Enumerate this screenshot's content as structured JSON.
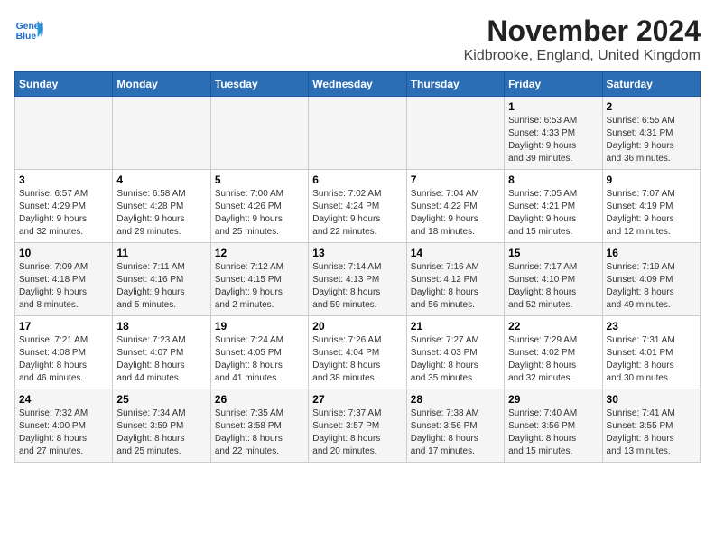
{
  "header": {
    "logo_line1": "General",
    "logo_line2": "Blue",
    "title": "November 2024",
    "subtitle": "Kidbrooke, England, United Kingdom"
  },
  "columns": [
    "Sunday",
    "Monday",
    "Tuesday",
    "Wednesday",
    "Thursday",
    "Friday",
    "Saturday"
  ],
  "weeks": [
    [
      {
        "day": "",
        "info": ""
      },
      {
        "day": "",
        "info": ""
      },
      {
        "day": "",
        "info": ""
      },
      {
        "day": "",
        "info": ""
      },
      {
        "day": "",
        "info": ""
      },
      {
        "day": "1",
        "info": "Sunrise: 6:53 AM\nSunset: 4:33 PM\nDaylight: 9 hours\nand 39 minutes."
      },
      {
        "day": "2",
        "info": "Sunrise: 6:55 AM\nSunset: 4:31 PM\nDaylight: 9 hours\nand 36 minutes."
      }
    ],
    [
      {
        "day": "3",
        "info": "Sunrise: 6:57 AM\nSunset: 4:29 PM\nDaylight: 9 hours\nand 32 minutes."
      },
      {
        "day": "4",
        "info": "Sunrise: 6:58 AM\nSunset: 4:28 PM\nDaylight: 9 hours\nand 29 minutes."
      },
      {
        "day": "5",
        "info": "Sunrise: 7:00 AM\nSunset: 4:26 PM\nDaylight: 9 hours\nand 25 minutes."
      },
      {
        "day": "6",
        "info": "Sunrise: 7:02 AM\nSunset: 4:24 PM\nDaylight: 9 hours\nand 22 minutes."
      },
      {
        "day": "7",
        "info": "Sunrise: 7:04 AM\nSunset: 4:22 PM\nDaylight: 9 hours\nand 18 minutes."
      },
      {
        "day": "8",
        "info": "Sunrise: 7:05 AM\nSunset: 4:21 PM\nDaylight: 9 hours\nand 15 minutes."
      },
      {
        "day": "9",
        "info": "Sunrise: 7:07 AM\nSunset: 4:19 PM\nDaylight: 9 hours\nand 12 minutes."
      }
    ],
    [
      {
        "day": "10",
        "info": "Sunrise: 7:09 AM\nSunset: 4:18 PM\nDaylight: 9 hours\nand 8 minutes."
      },
      {
        "day": "11",
        "info": "Sunrise: 7:11 AM\nSunset: 4:16 PM\nDaylight: 9 hours\nand 5 minutes."
      },
      {
        "day": "12",
        "info": "Sunrise: 7:12 AM\nSunset: 4:15 PM\nDaylight: 9 hours\nand 2 minutes."
      },
      {
        "day": "13",
        "info": "Sunrise: 7:14 AM\nSunset: 4:13 PM\nDaylight: 8 hours\nand 59 minutes."
      },
      {
        "day": "14",
        "info": "Sunrise: 7:16 AM\nSunset: 4:12 PM\nDaylight: 8 hours\nand 56 minutes."
      },
      {
        "day": "15",
        "info": "Sunrise: 7:17 AM\nSunset: 4:10 PM\nDaylight: 8 hours\nand 52 minutes."
      },
      {
        "day": "16",
        "info": "Sunrise: 7:19 AM\nSunset: 4:09 PM\nDaylight: 8 hours\nand 49 minutes."
      }
    ],
    [
      {
        "day": "17",
        "info": "Sunrise: 7:21 AM\nSunset: 4:08 PM\nDaylight: 8 hours\nand 46 minutes."
      },
      {
        "day": "18",
        "info": "Sunrise: 7:23 AM\nSunset: 4:07 PM\nDaylight: 8 hours\nand 44 minutes."
      },
      {
        "day": "19",
        "info": "Sunrise: 7:24 AM\nSunset: 4:05 PM\nDaylight: 8 hours\nand 41 minutes."
      },
      {
        "day": "20",
        "info": "Sunrise: 7:26 AM\nSunset: 4:04 PM\nDaylight: 8 hours\nand 38 minutes."
      },
      {
        "day": "21",
        "info": "Sunrise: 7:27 AM\nSunset: 4:03 PM\nDaylight: 8 hours\nand 35 minutes."
      },
      {
        "day": "22",
        "info": "Sunrise: 7:29 AM\nSunset: 4:02 PM\nDaylight: 8 hours\nand 32 minutes."
      },
      {
        "day": "23",
        "info": "Sunrise: 7:31 AM\nSunset: 4:01 PM\nDaylight: 8 hours\nand 30 minutes."
      }
    ],
    [
      {
        "day": "24",
        "info": "Sunrise: 7:32 AM\nSunset: 4:00 PM\nDaylight: 8 hours\nand 27 minutes."
      },
      {
        "day": "25",
        "info": "Sunrise: 7:34 AM\nSunset: 3:59 PM\nDaylight: 8 hours\nand 25 minutes."
      },
      {
        "day": "26",
        "info": "Sunrise: 7:35 AM\nSunset: 3:58 PM\nDaylight: 8 hours\nand 22 minutes."
      },
      {
        "day": "27",
        "info": "Sunrise: 7:37 AM\nSunset: 3:57 PM\nDaylight: 8 hours\nand 20 minutes."
      },
      {
        "day": "28",
        "info": "Sunrise: 7:38 AM\nSunset: 3:56 PM\nDaylight: 8 hours\nand 17 minutes."
      },
      {
        "day": "29",
        "info": "Sunrise: 7:40 AM\nSunset: 3:56 PM\nDaylight: 8 hours\nand 15 minutes."
      },
      {
        "day": "30",
        "info": "Sunrise: 7:41 AM\nSunset: 3:55 PM\nDaylight: 8 hours\nand 13 minutes."
      }
    ]
  ]
}
